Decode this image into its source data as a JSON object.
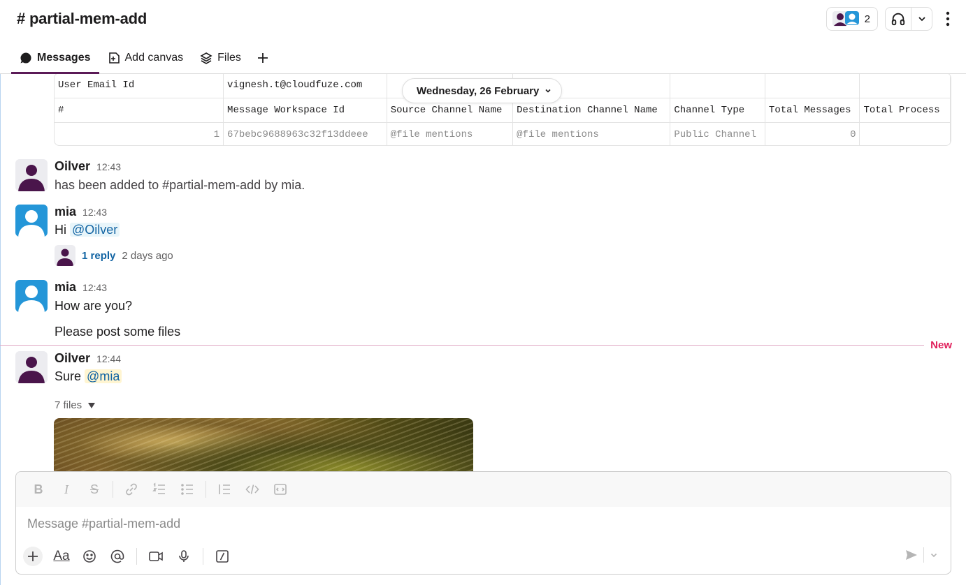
{
  "channel": {
    "title": "# partial-mem-add",
    "member_count": "2"
  },
  "tabs": [
    {
      "label": "Messages",
      "active": true,
      "icon": "message-bubble-icon"
    },
    {
      "label": "Add canvas",
      "active": false,
      "icon": "canvas-icon"
    },
    {
      "label": "Files",
      "active": false,
      "icon": "files-stack-icon"
    }
  ],
  "date_divider": "Wednesday, 26 February",
  "report_table": {
    "row1": [
      "User Email Id",
      "vignesh.t@cloudfuze.com"
    ],
    "headers": [
      "#",
      "Message Workspace Id",
      "Source Channel Name",
      "Destination Channel Name",
      "Channel Type",
      "Total Messages",
      "Total Process"
    ],
    "values": [
      "1",
      "67bebc9688963c32f13ddeee",
      "@file mentions",
      "@file mentions",
      "Public Channel",
      "0",
      ""
    ]
  },
  "messages": [
    {
      "name": "Oilver",
      "time": "12:43",
      "text": "has been added to #partial-mem-add by mia."
    },
    {
      "name": "mia",
      "time": "12:43",
      "text_prefix": "Hi",
      "mention": "@Oilver",
      "reply_count": "1 reply",
      "reply_when": "2 days ago"
    },
    {
      "name": "mia",
      "time": "12:43",
      "line1": "How are you?",
      "line2": "Please post some files"
    },
    {
      "name": "Oilver",
      "time": "12:44",
      "text_prefix": "Sure",
      "mention": "@mia",
      "files_label": "7 files"
    }
  ],
  "new_label": "New",
  "composer": {
    "placeholder": "Message #partial-mem-add"
  },
  "colors": {
    "accent": "#5b1a57",
    "link": "#1264a3",
    "new": "#e01e5a",
    "avatar_blue": "#2496d8"
  }
}
